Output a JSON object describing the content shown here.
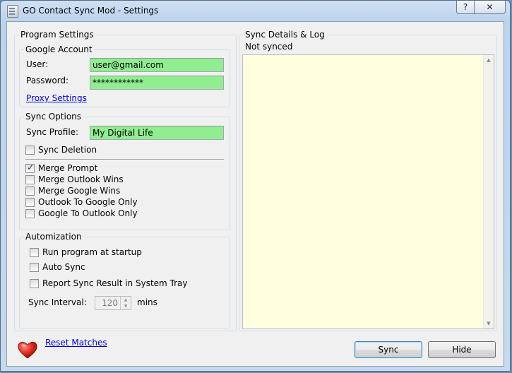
{
  "window": {
    "title": "GO Contact Sync Mod - Settings",
    "help_glyph": "?",
    "close_glyph": "✕"
  },
  "program_settings": {
    "legend": "Program Settings",
    "google_account": {
      "legend": "Google Account",
      "user_label": "User:",
      "user_value": "user@gmail.com",
      "password_label": "Password:",
      "password_value": "************",
      "proxy_link": "Proxy Settings"
    },
    "sync_options": {
      "legend": "Sync Options",
      "profile_label": "Sync Profile:",
      "profile_value": "My Digital Life",
      "sync_deletion": {
        "label": "Sync Deletion",
        "checked": false
      },
      "merge_options": [
        {
          "label": "Merge Prompt",
          "checked": true
        },
        {
          "label": "Merge Outlook Wins",
          "checked": false
        },
        {
          "label": "Merge Google Wins",
          "checked": false
        },
        {
          "label": "Outlook To Google Only",
          "checked": false
        },
        {
          "label": "Google To Outlook Only",
          "checked": false
        }
      ]
    },
    "automization": {
      "legend": "Automization",
      "run_at_startup": {
        "label": "Run program at startup",
        "checked": false
      },
      "auto_sync": {
        "label": "Auto Sync",
        "checked": false
      },
      "report_result": {
        "label": "Report Sync Result in System Tray",
        "checked": false
      },
      "interval_label": "Sync Interval:",
      "interval_value": "120",
      "interval_unit": "mins"
    }
  },
  "sync_log": {
    "legend": "Sync Details & Log",
    "status": "Not synced"
  },
  "footer": {
    "reset_link": "Reset Matches",
    "sync_button": "Sync",
    "hide_button": "Hide"
  },
  "colors": {
    "field_background": "#90ee90",
    "log_background": "#ffffe0",
    "link": "#0000ee"
  }
}
